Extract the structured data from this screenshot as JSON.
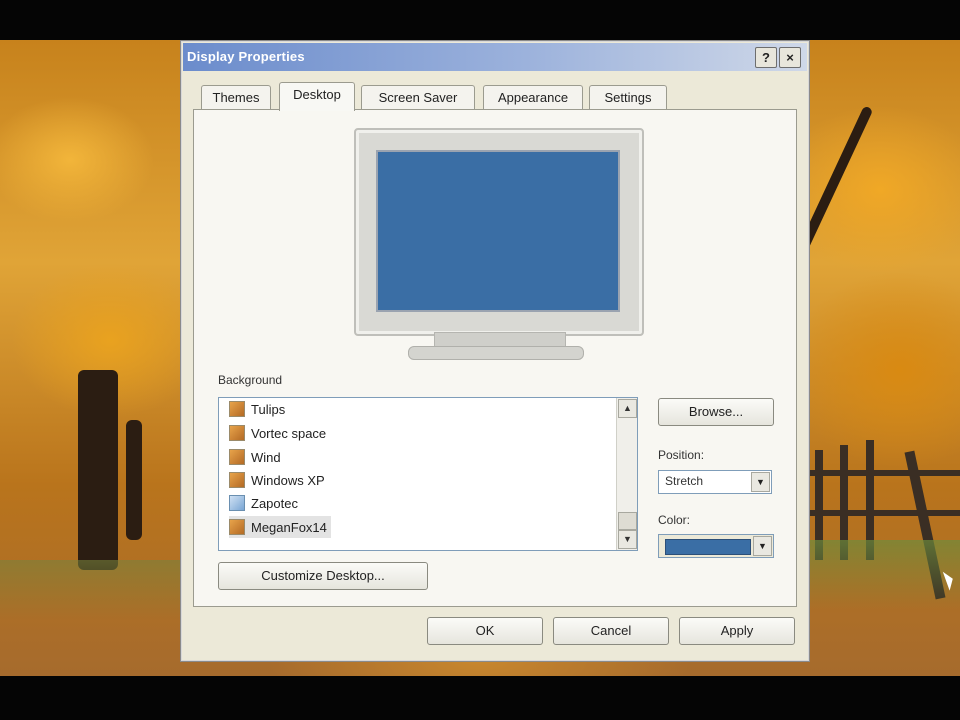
{
  "window": {
    "title": "Display Properties",
    "help_label": "?",
    "close_label": "×"
  },
  "tabs": [
    {
      "label": "Themes"
    },
    {
      "label": "Desktop"
    },
    {
      "label": "Screen Saver"
    },
    {
      "label": "Appearance"
    },
    {
      "label": "Settings"
    }
  ],
  "active_tab": "Desktop",
  "background": {
    "label": "Background",
    "items": [
      {
        "label": "Tulips",
        "icon": "bitmap-icon"
      },
      {
        "label": "Vortec space",
        "icon": "bitmap-icon"
      },
      {
        "label": "Wind",
        "icon": "bitmap-icon"
      },
      {
        "label": "Windows XP",
        "icon": "bitmap-icon"
      },
      {
        "label": "Zapotec",
        "icon": "jpeg-icon"
      },
      {
        "label": "MeganFox14",
        "icon": "bitmap-icon"
      }
    ],
    "selected": "MeganFox14",
    "scroll_up": "▲",
    "scroll_down": "▼"
  },
  "browse_label": "Browse...",
  "position": {
    "label": "Position:",
    "value": "Stretch",
    "arrow": "▼"
  },
  "color": {
    "label": "Color:",
    "value_hex": "#3a6ea5",
    "arrow": "▼"
  },
  "customize_label": "Customize Desktop...",
  "footer": {
    "ok": "OK",
    "cancel": "Cancel",
    "apply": "Apply"
  },
  "colors": {
    "accent": "#3a6ea5",
    "titlebar_start": "#6b8ccc",
    "dialog_bg": "#ece9d8"
  }
}
